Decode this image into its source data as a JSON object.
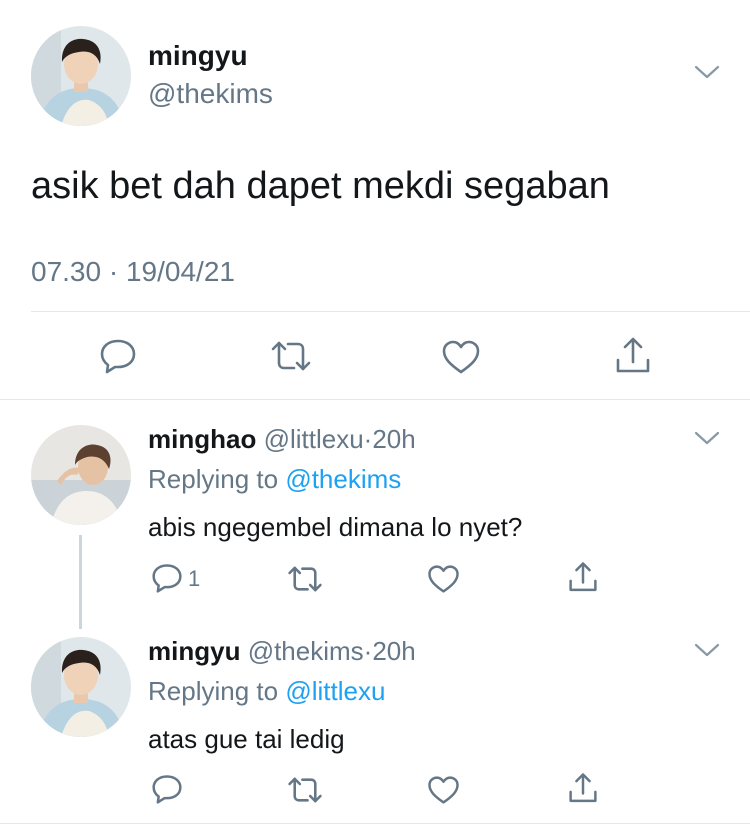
{
  "main_tweet": {
    "display_name": "mingyu",
    "handle": "@thekims",
    "text": "asik bet dah dapet mekdi segaban",
    "time": "07.30",
    "separator": "·",
    "date": "19/04/21",
    "avatar_icon": "profile-photo"
  },
  "replies": [
    {
      "display_name": "minghao",
      "handle": "@littlexu",
      "separator": "·",
      "age": "20h",
      "replying_prefix": "Replying to",
      "replying_to": "@thekims",
      "text": "abis ngegembel dimana lo nyet?",
      "reply_count": "1"
    },
    {
      "display_name": "mingyu",
      "handle": "@thekims",
      "separator": "·",
      "age": "20h",
      "replying_prefix": "Replying to",
      "replying_to": "@littlexu",
      "text": "atas gue tai ledig",
      "reply_count": ""
    }
  ],
  "colors": {
    "text": "#14171a",
    "secondary": "#657786",
    "link": "#1da1f2",
    "divider": "#e1e8ed",
    "icon": "#657786"
  },
  "icons": {
    "reply": "reply-icon",
    "retweet": "retweet-icon",
    "like": "heart-icon",
    "share": "share-icon",
    "menu": "chevron-down-icon"
  }
}
